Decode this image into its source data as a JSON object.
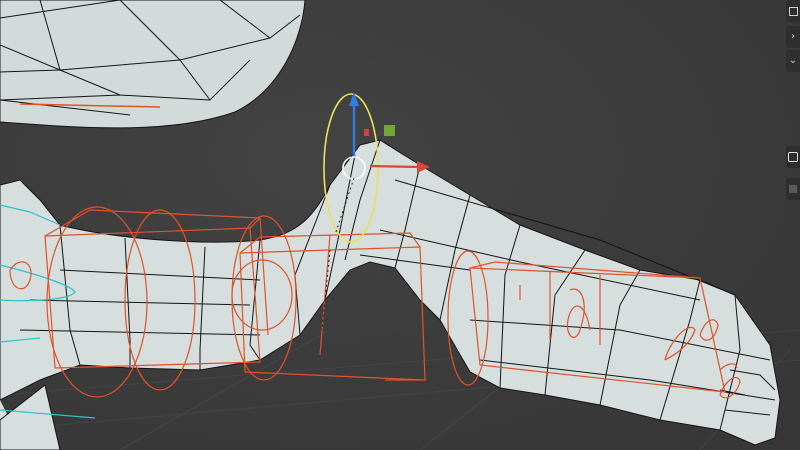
{
  "viewport": {
    "background": "#3a3a3a",
    "mesh_color": "#d7dfdf",
    "wire_color": "#111111",
    "rig_color": "#e0532a",
    "gizmo_x_color": "#e0443a",
    "gizmo_z_color": "#2f7de0",
    "gizmo_rotate_color": "#e8e35a",
    "gizmo_handle_color": "#6fa92f",
    "bone_color": "#2bc4c8"
  },
  "right_strip": {
    "icons": [
      "square-icon",
      "chevron-right-icon",
      "chevron-down-icon",
      "tool-icon",
      "square-icon"
    ]
  }
}
